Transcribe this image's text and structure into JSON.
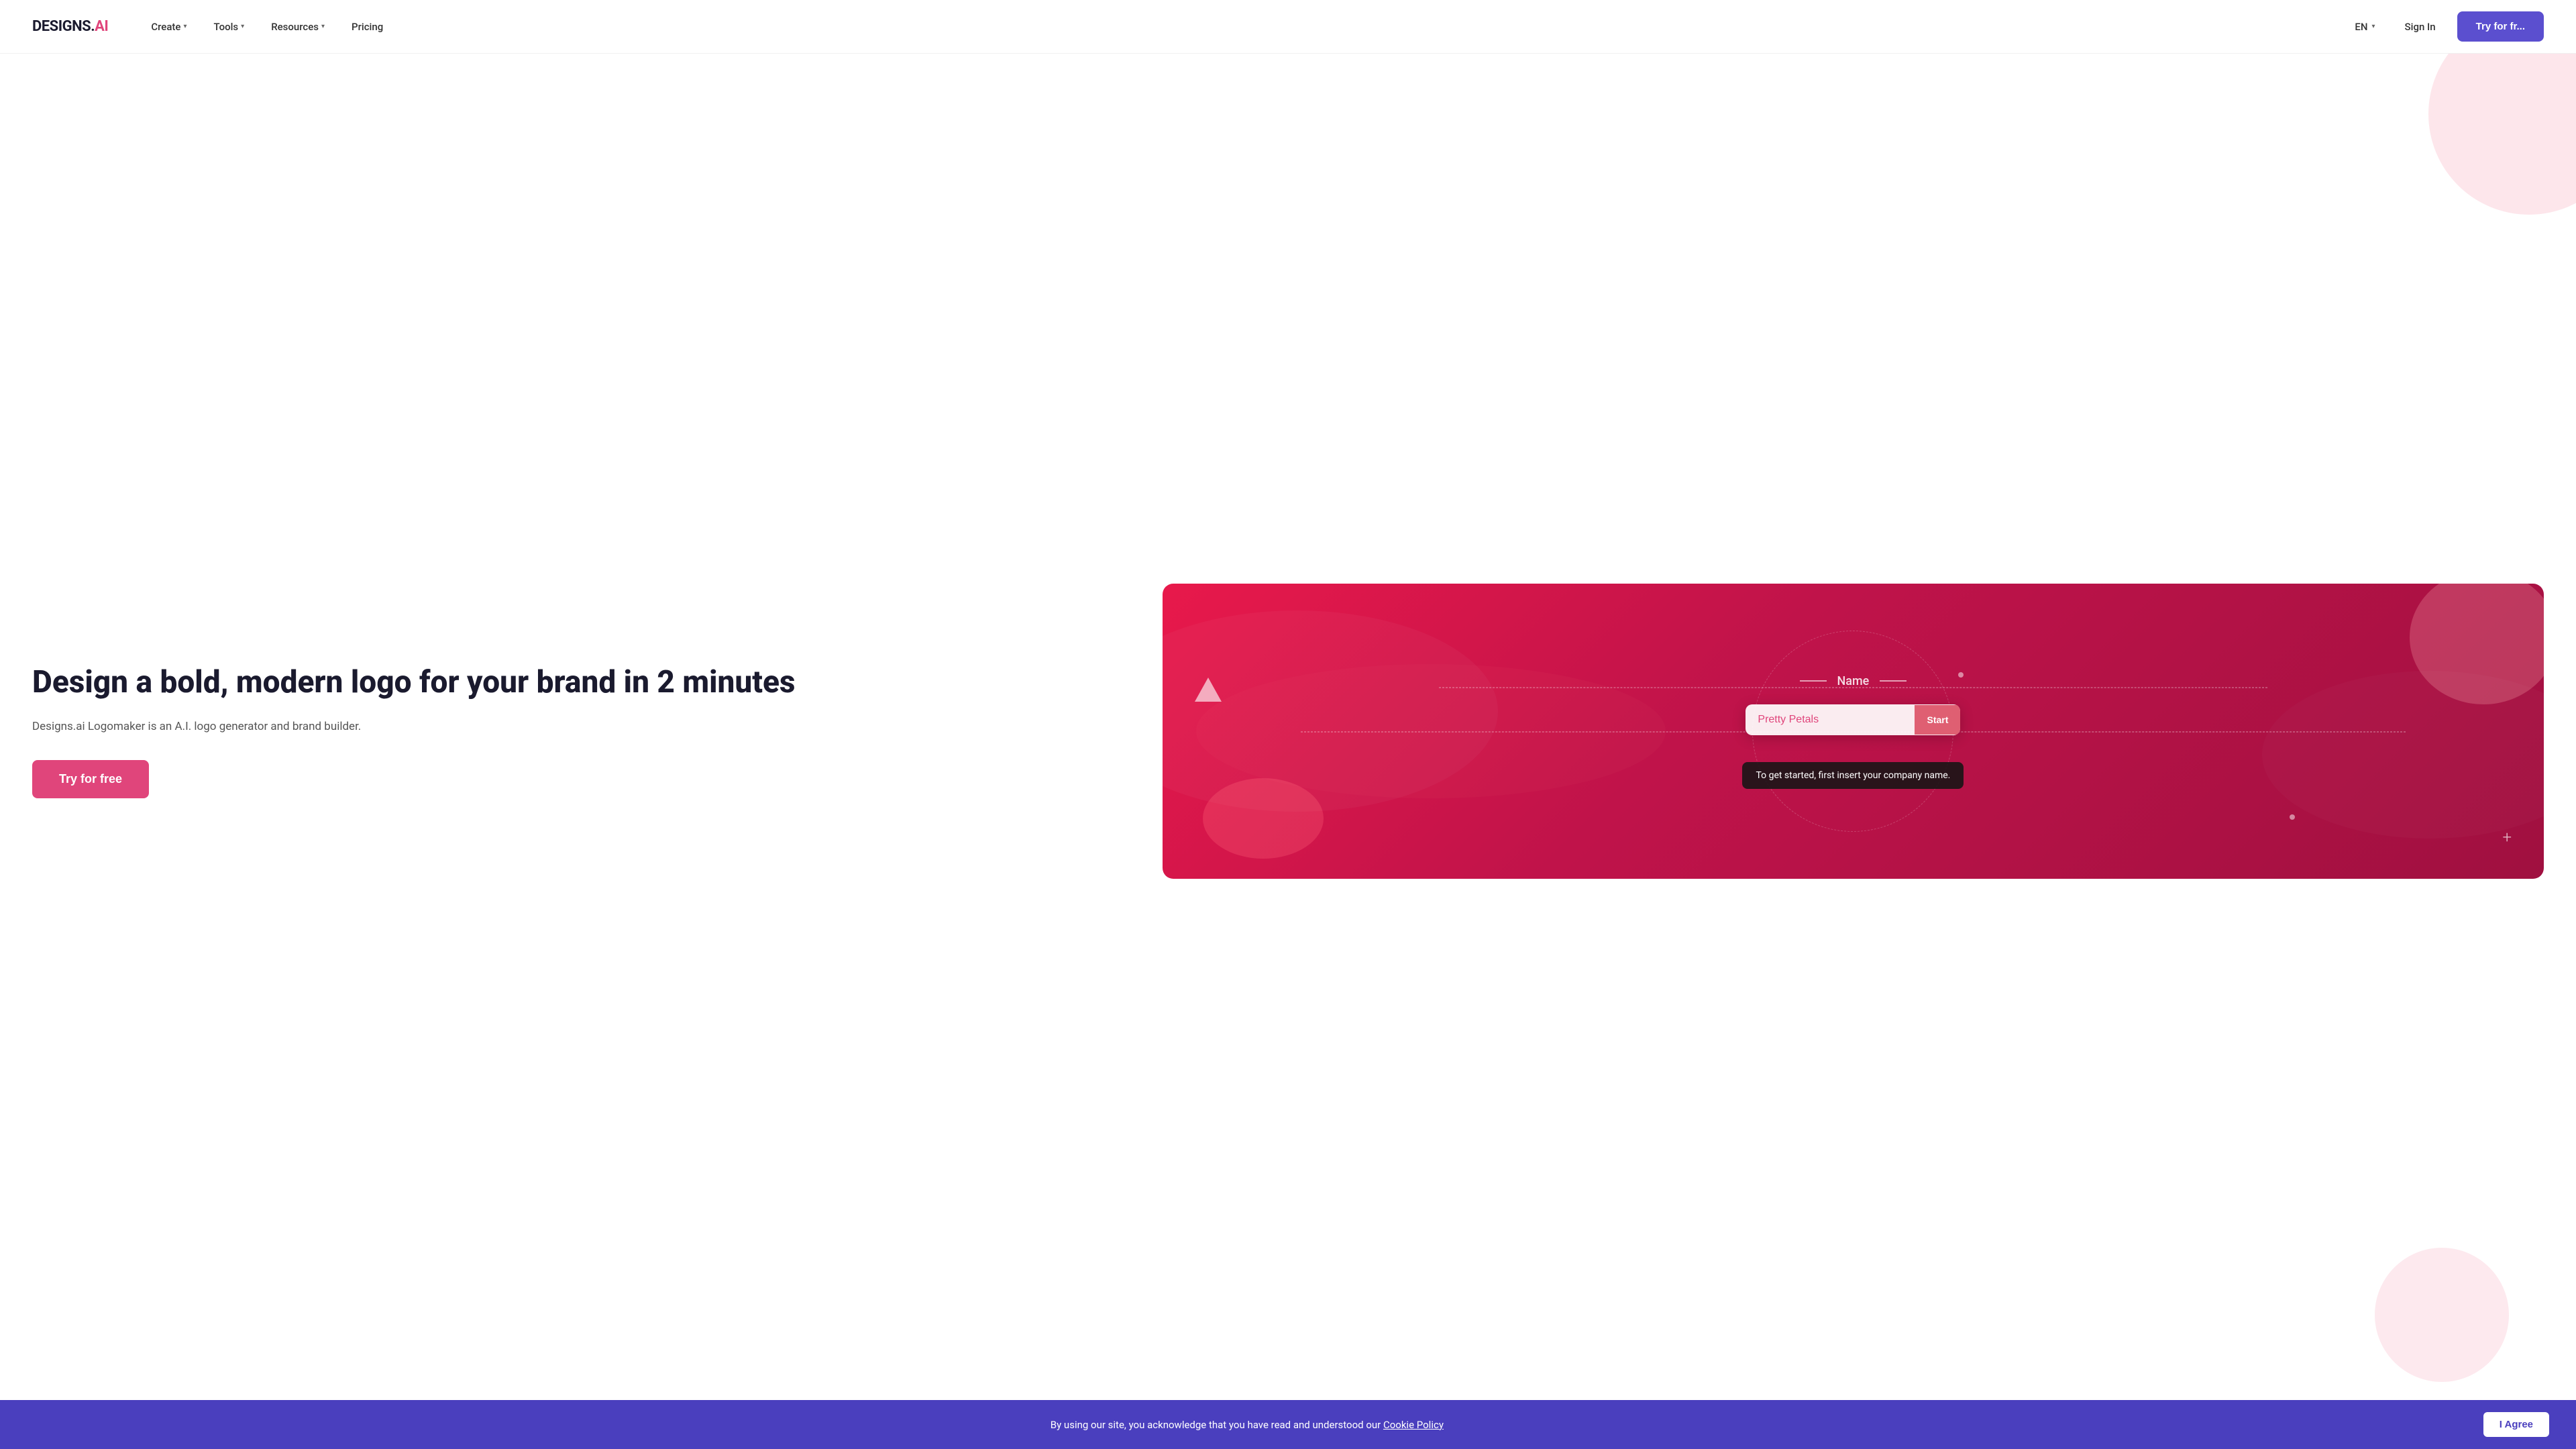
{
  "nav": {
    "logo_text": "DESIGNS.",
    "logo_ai": "AI",
    "items": [
      {
        "label": "Create",
        "has_chevron": true
      },
      {
        "label": "Tools",
        "has_chevron": true
      },
      {
        "label": "Resources",
        "has_chevron": true
      },
      {
        "label": "Pricing",
        "has_chevron": false
      }
    ],
    "lang": "EN",
    "sign_in": "Sign In",
    "try_btn": "Try for fr..."
  },
  "hero": {
    "title": "Design a bold, modern logo for your brand in 2 minutes",
    "subtitle": "Designs.ai Logomaker is an A.I. logo generator and brand builder.",
    "cta_label": "Try for free"
  },
  "demo": {
    "name_label": "Name",
    "input_value": "Pretty Petals",
    "start_btn": "Start",
    "tooltip": "To get started, first insert your company name."
  },
  "cookie": {
    "text": "By using our site, you acknowledge that you have read and understood our ",
    "link_text": "Cookie Policy",
    "agree_btn": "I Agree"
  }
}
